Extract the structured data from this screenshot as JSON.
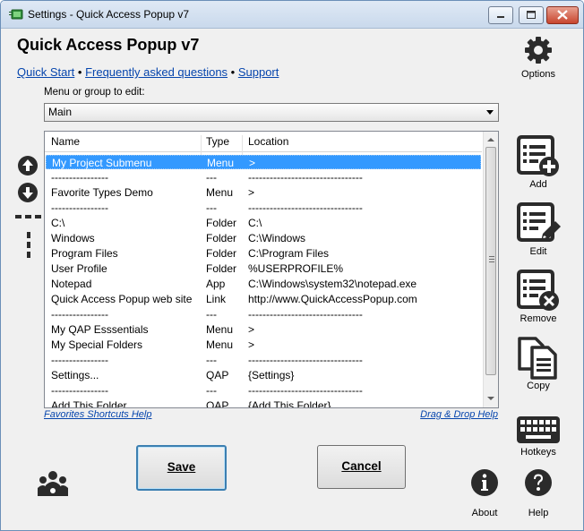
{
  "window": {
    "title": "Settings - Quick Access Popup v7"
  },
  "app_title": "Quick Access Popup v7",
  "links": {
    "quick_start": "Quick Start",
    "sep1": " • ",
    "faq": "Frequently asked questions",
    "sep2": " • ",
    "support": "Support"
  },
  "menu_select": {
    "label": "Menu or group to edit:",
    "value": "Main"
  },
  "list": {
    "columns": {
      "name": "Name",
      "type": "Type",
      "location": "Location"
    },
    "rows": [
      {
        "name": "My Project Submenu",
        "type": "Menu",
        "location": ">"
      },
      {
        "name": "----------------",
        "type": "---",
        "location": "--------------------------------"
      },
      {
        "name": "Favorite Types Demo",
        "type": "Menu",
        "location": ">"
      },
      {
        "name": "----------------",
        "type": "---",
        "location": "--------------------------------"
      },
      {
        "name": "C:\\",
        "type": "Folder",
        "location": "C:\\"
      },
      {
        "name": "Windows",
        "type": "Folder",
        "location": "C:\\Windows"
      },
      {
        "name": "Program Files",
        "type": "Folder",
        "location": "C:\\Program Files"
      },
      {
        "name": "User Profile",
        "type": "Folder",
        "location": "%USERPROFILE%"
      },
      {
        "name": "Notepad",
        "type": "App",
        "location": "C:\\Windows\\system32\\notepad.exe"
      },
      {
        "name": "Quick Access Popup web site",
        "type": "Link",
        "location": "http://www.QuickAccessPopup.com"
      },
      {
        "name": "----------------",
        "type": "---",
        "location": "--------------------------------"
      },
      {
        "name": "My QAP Esssentials",
        "type": "Menu",
        "location": ">"
      },
      {
        "name": "My Special Folders",
        "type": "Menu",
        "location": ">"
      },
      {
        "name": "----------------",
        "type": "---",
        "location": "--------------------------------"
      },
      {
        "name": "Settings...",
        "type": "QAP",
        "location": "{Settings}"
      },
      {
        "name": "----------------",
        "type": "---",
        "location": "--------------------------------"
      },
      {
        "name": "Add This Folder",
        "type": "QAP",
        "location": "{Add This Folder}"
      }
    ]
  },
  "help_links": {
    "favorites_shortcuts": "Favorites Shortcuts Help",
    "drag_drop": "Drag & Drop Help"
  },
  "buttons": {
    "save": "Save",
    "cancel": "Cancel"
  },
  "sidebar": {
    "options": "Options",
    "add": "Add",
    "edit": "Edit",
    "remove": "Remove",
    "copy": "Copy",
    "hotkeys": "Hotkeys"
  },
  "footer": {
    "about": "About",
    "help": "Help"
  },
  "colors": {
    "selection": "#3399ff",
    "link": "#0645ad",
    "icon": "#2b2b2b"
  }
}
